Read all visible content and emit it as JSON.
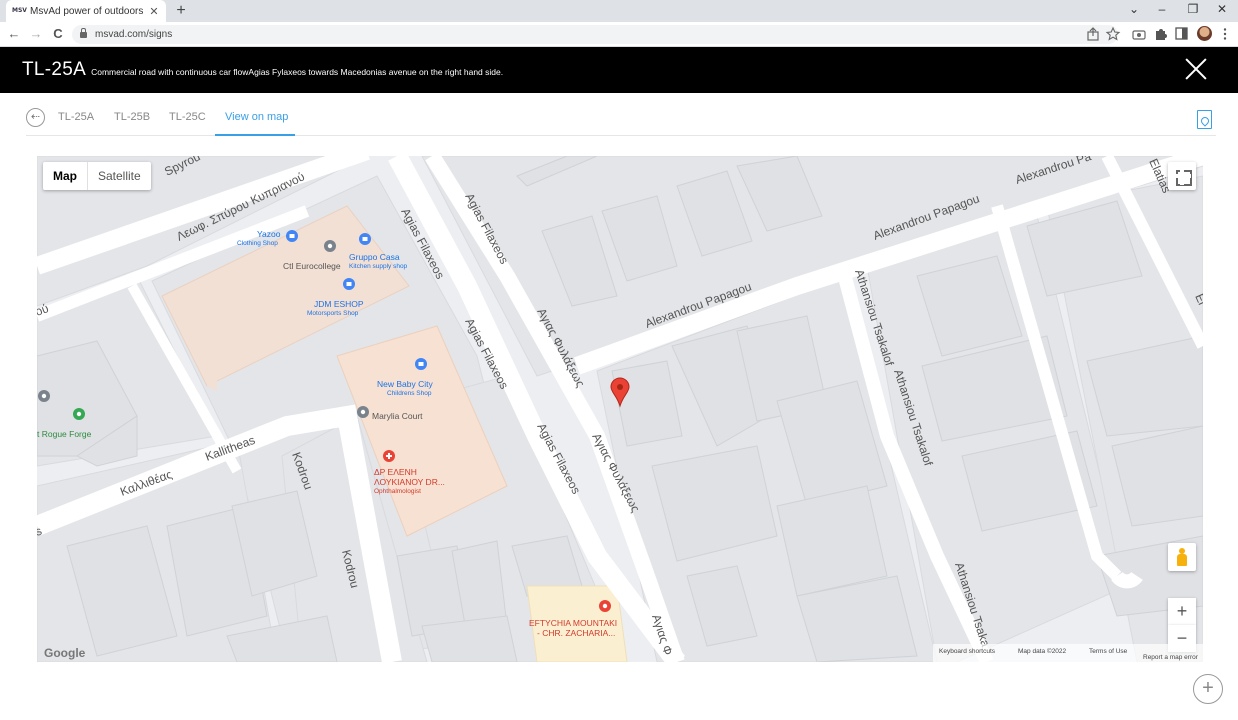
{
  "browser": {
    "tab_favicon": "MSV",
    "tab_title": "MsvAd power of outdoors",
    "tab_close": "✕",
    "new_tab": "+",
    "url": "msvad.com/signs",
    "controls": {
      "back": "←",
      "forward": "→",
      "reload": "C",
      "chevron": "⌄",
      "minimize": "–",
      "restore": "❐",
      "close": "✕"
    },
    "toolbar_icons": [
      "share-icon",
      "star-icon",
      "camera-icon",
      "puzzle-icon",
      "sidepanel-icon",
      "avatar",
      "kebab-menu-icon"
    ]
  },
  "header": {
    "sign_code": "TL-25A",
    "description": "Commercial road with continuous car flowAgias Fylaxeos towards Macedonias avenue on the right hand side."
  },
  "tabs": [
    {
      "label": "TL-25A",
      "active": false
    },
    {
      "label": "TL-25B",
      "active": false
    },
    {
      "label": "TL-25C",
      "active": false
    },
    {
      "label": "View on map",
      "active": true
    }
  ],
  "map": {
    "type_buttons": {
      "map": "Map",
      "satellite": "Satellite"
    },
    "streets": {
      "kyprianou": "Λεωφ. Σπύρου Κυπριανού",
      "sprgou": "Spyrou",
      "agias1": "Agias Filaxeos",
      "agias2": "Agias Filaxeos",
      "agias3": "Agias Filaxeos",
      "agias4": "Agias Filaxeos",
      "agias_gr1": "Αγιας Φυλάξεως",
      "agias_gr2": "Αγιας Φυλάξεως",
      "agias_gr3": "Αγιας Φ",
      "papagou1": "Alexandrou Papagou",
      "papagou2": "Alexandrou Papagou",
      "papagou3": "Alexandrou Pa",
      "tsakalof1": "Athansiou Tsakalof",
      "tsakalof2": "Athansiou Tsakalof",
      "tsakalof3": "Athansiou Tsaka",
      "elatias": "Elatias",
      "kallitheas": "Kallitheas",
      "kallitheas_gr": "Καλλιθέας",
      "kodrou1": "Kodrou",
      "kodrou2": "Kodrou",
      "frag_ou": "ού",
      "frag_s": "s",
      "frag_el": "El"
    },
    "pois": {
      "yazoo": {
        "name": "Yazoo",
        "sub": "Clothing Shop"
      },
      "eurocollege": {
        "name": "Ctl Eurocollege"
      },
      "gruppo": {
        "name": "Gruppo Casa",
        "sub": "Kitchen supply shop"
      },
      "jdm": {
        "name": "JDM ESHOP",
        "sub": "Motorsports Shop"
      },
      "babycity": {
        "name": "New Baby City",
        "sub": "Childrens Shop"
      },
      "marylia": {
        "name": "Marylia Court"
      },
      "rogue": {
        "name": "t Rogue Forge"
      },
      "doctor": {
        "name1": "ΔΡ ΕΛΕΝΗ",
        "name2": "ΛΟΥΚΙΑΝΟΥ DR...",
        "sub": "Ophthalmologist"
      },
      "eftychia": {
        "name1": "EFTYCHIA MOUNTAKI",
        "name2": "- CHR. ZACHARIA..."
      }
    },
    "zoom_in": "+",
    "zoom_out": "−",
    "logo": "Google",
    "attribution": {
      "shortcuts": "Keyboard shortcuts",
      "data": "Map data ©2022",
      "terms": "Terms of Use",
      "report": "Report a map error"
    }
  },
  "fab": "+"
}
